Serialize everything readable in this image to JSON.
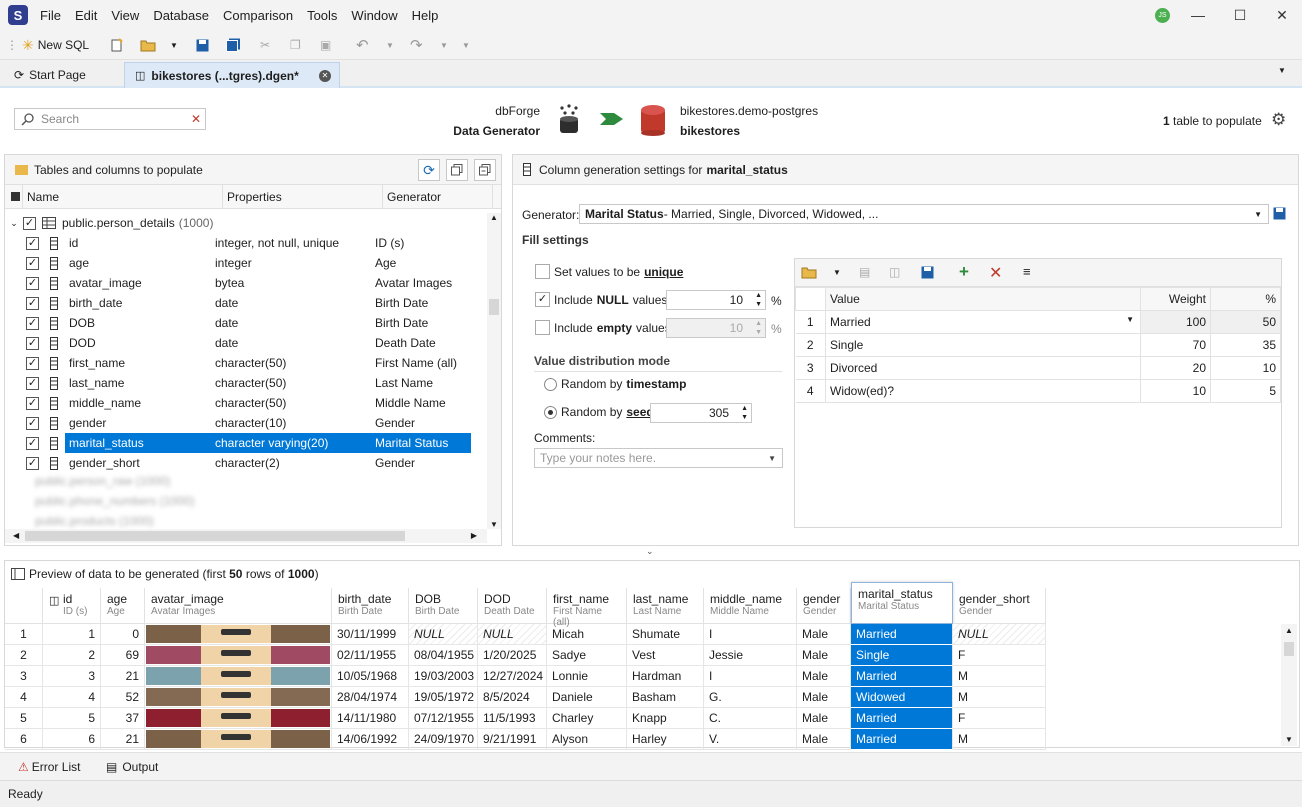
{
  "app": {
    "logo": "S",
    "user_initials": "JS"
  },
  "menu": [
    "File",
    "Edit",
    "View",
    "Database",
    "Comparison",
    "Tools",
    "Window",
    "Help"
  ],
  "toolbar": {
    "new_sql": "New SQL"
  },
  "tabs": [
    {
      "label": "Start Page"
    },
    {
      "label": "bikestores (...tgres).dgen*"
    }
  ],
  "header": {
    "search_placeholder": "Search",
    "product_line1": "dbForge",
    "product_line2": "Data Generator",
    "connection": "bikestores.demo-postgres",
    "database": "bikestores",
    "populate_count": "1",
    "populate_text": "table to populate"
  },
  "tree": {
    "title": "Tables and columns to populate",
    "columns": [
      "Name",
      "Properties",
      "Generator"
    ],
    "table": "public.person_details",
    "table_count": "(1000)",
    "rows": [
      {
        "name": "id",
        "props": "integer, not null, unique",
        "gen": "ID (s)"
      },
      {
        "name": "age",
        "props": "integer",
        "gen": "Age"
      },
      {
        "name": "avatar_image",
        "props": "bytea",
        "gen": "Avatar Images"
      },
      {
        "name": "birth_date",
        "props": "date",
        "gen": "Birth Date"
      },
      {
        "name": "DOB",
        "props": "date",
        "gen": "Birth Date"
      },
      {
        "name": "DOD",
        "props": "date",
        "gen": "Death Date"
      },
      {
        "name": "first_name",
        "props": "character(50)",
        "gen": "First Name (all)"
      },
      {
        "name": "last_name",
        "props": "character(50)",
        "gen": "Last Name"
      },
      {
        "name": "middle_name",
        "props": "character(50)",
        "gen": "Middle Name"
      },
      {
        "name": "gender",
        "props": "character(10)",
        "gen": "Gender"
      },
      {
        "name": "marital_status",
        "props": "character varying(20)",
        "gen": "Marital Status"
      },
      {
        "name": "gender_short",
        "props": "character(2)",
        "gen": "Gender"
      }
    ],
    "blurred": [
      "public.person_raw (1000)",
      "public.phone_numbers (1000)",
      "public.products (1000)"
    ]
  },
  "settings": {
    "title_prefix": "Column generation settings for",
    "column": "marital_status",
    "generator_label": "Generator:",
    "generator_name": "Marital Status",
    "generator_desc": " - Married, Single, Divorced, Widowed, ...",
    "fill_settings": "Fill settings",
    "unique_label": "Set values to be",
    "unique_bold": "unique",
    "null_label": "Include",
    "null_bold": "NULL",
    "null_tail": "values",
    "null_value": "10",
    "empty_label": "Include",
    "empty_bold": "empty",
    "empty_tail": "values",
    "empty_value": "10",
    "percent": "%",
    "dist_mode": "Value distribution mode",
    "random_ts": "Random by",
    "random_ts_bold": "timestamp",
    "random_seed": "Random by",
    "random_seed_bold": "seed",
    "seed_value": "305",
    "comments_label": "Comments:",
    "comments_placeholder": "Type your notes here.",
    "values_table": {
      "headers": [
        "Value",
        "Weight",
        "%"
      ],
      "rows": [
        {
          "n": "1",
          "value": "Married",
          "weight": "100",
          "pct": "50"
        },
        {
          "n": "2",
          "value": "Single",
          "weight": "70",
          "pct": "35"
        },
        {
          "n": "3",
          "value": "Divorced",
          "weight": "20",
          "pct": "10"
        },
        {
          "n": "4",
          "value": "Widow(ed)?",
          "weight": "10",
          "pct": "5"
        }
      ]
    }
  },
  "preview": {
    "title_pre": "Preview of data to be generated (first",
    "first": "50",
    "title_mid": "rows of",
    "total": "1000",
    "title_post": ")",
    "columns": [
      {
        "name": "id",
        "sub": "ID (s)"
      },
      {
        "name": "age",
        "sub": "Age"
      },
      {
        "name": "avatar_image",
        "sub": "Avatar Images"
      },
      {
        "name": "birth_date",
        "sub": "Birth Date"
      },
      {
        "name": "DOB",
        "sub": "Birth Date"
      },
      {
        "name": "DOD",
        "sub": "Death Date"
      },
      {
        "name": "first_name",
        "sub": "First Name (all)"
      },
      {
        "name": "last_name",
        "sub": "Last Name"
      },
      {
        "name": "middle_name",
        "sub": "Middle Name"
      },
      {
        "name": "gender",
        "sub": "Gender"
      },
      {
        "name": "marital_status",
        "sub": "Marital Status"
      },
      {
        "name": "gender_short",
        "sub": "Gender"
      }
    ],
    "rows": [
      {
        "n": "1",
        "id": "1",
        "age": "0",
        "color": "#7a6148",
        "birth": "30/11/1999",
        "dob": "NULL",
        "dod": "NULL",
        "first": "Micah",
        "last": "Shumate",
        "middle": "I",
        "gender": "Male",
        "marital": "Married",
        "gs": "NULL"
      },
      {
        "n": "2",
        "id": "2",
        "age": "69",
        "color": "#a04a63",
        "birth": "02/11/1955",
        "dob": "08/04/1955",
        "dod": "1/20/2025",
        "first": "Sadye",
        "last": "Vest",
        "middle": "Jessie",
        "gender": "Male",
        "marital": "Single",
        "gs": "F"
      },
      {
        "n": "3",
        "id": "3",
        "age": "21",
        "color": "#7ba2ad",
        "birth": "10/05/1968",
        "dob": "19/03/2003",
        "dod": "12/27/2024",
        "first": "Lonnie",
        "last": "Hardman",
        "middle": "I",
        "gender": "Male",
        "marital": "Married",
        "gs": "M"
      },
      {
        "n": "4",
        "id": "4",
        "age": "52",
        "color": "#846a52",
        "birth": "28/04/1974",
        "dob": "19/05/1972",
        "dod": "8/5/2024",
        "first": "Daniele",
        "last": "Basham",
        "middle": "G.",
        "gender": "Male",
        "marital": "Widowed",
        "gs": "M"
      },
      {
        "n": "5",
        "id": "5",
        "age": "37",
        "color": "#8e1f2e",
        "birth": "14/11/1980",
        "dob": "07/12/1955",
        "dod": "11/5/1993",
        "first": "Charley",
        "last": "Knapp",
        "middle": "C.",
        "gender": "Male",
        "marital": "Married",
        "gs": "F"
      },
      {
        "n": "6",
        "id": "6",
        "age": "21",
        "color": "#7a6148",
        "birth": "14/06/1992",
        "dob": "24/09/1970",
        "dod": "9/21/1991",
        "first": "Alyson",
        "last": "Harley",
        "middle": "V.",
        "gender": "Male",
        "marital": "Married",
        "gs": "M"
      }
    ]
  },
  "bottom": {
    "error_list": "Error List",
    "output": "Output"
  },
  "status": "Ready"
}
